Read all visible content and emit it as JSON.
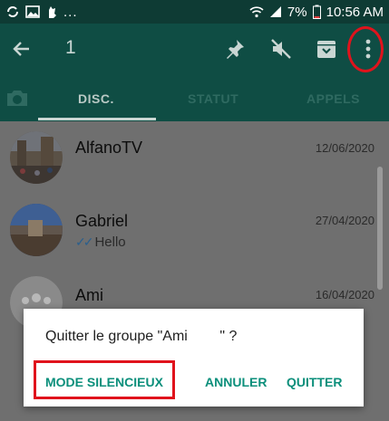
{
  "status_bar": {
    "dots": "...",
    "battery": "7%",
    "time": "10:56 AM"
  },
  "action_bar": {
    "selected_count": "1",
    "icons": [
      "back-arrow-icon",
      "pin-icon",
      "mute-icon",
      "archive-icon",
      "more-vert-icon"
    ]
  },
  "tabs": {
    "items": [
      {
        "label": "DISC.",
        "active": true
      },
      {
        "label": "STATUT",
        "active": false
      },
      {
        "label": "APPELS",
        "active": false
      }
    ]
  },
  "chats": [
    {
      "name": "AlfanoTV",
      "date": "12/06/2020",
      "preview": ""
    },
    {
      "name": "Gabriel",
      "date": "27/04/2020",
      "preview": "Hello"
    },
    {
      "name": "Ami",
      "date": "16/04/2020",
      "preview": ""
    }
  ],
  "dialog": {
    "message": "Quitter le groupe \"Ami        \" ?",
    "mute_button": "MODE SILENCIEUX",
    "cancel_button": "ANNULER",
    "quit_button": "QUITTER"
  },
  "colors": {
    "header": "#0f4d44",
    "status_bar": "#0e3b34",
    "accent": "#0b8f7b",
    "highlight": "#e0131c"
  }
}
